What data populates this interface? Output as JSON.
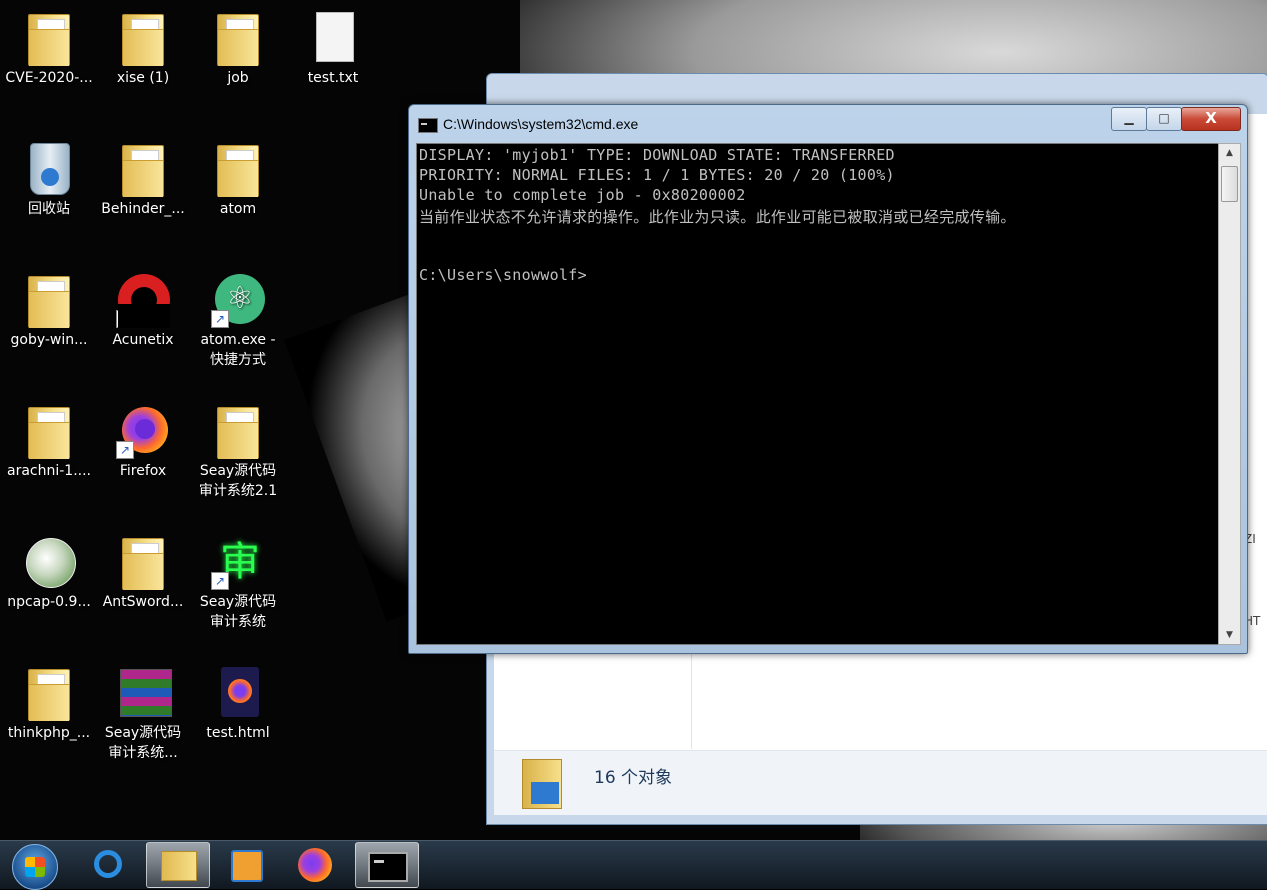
{
  "desktop": {
    "icons": [
      {
        "label": "CVE-2020-...",
        "icon": "folder-icon"
      },
      {
        "label": "xise (1)",
        "icon": "folder-icon"
      },
      {
        "label": "job",
        "icon": "folder-icon"
      },
      {
        "label": "test.txt",
        "icon": "text-file-icon"
      },
      {
        "label": "回收站",
        "icon": "recycle-bin-icon"
      },
      {
        "label": "Behinder_...",
        "icon": "folder-icon"
      },
      {
        "label": "atom",
        "icon": "folder-icon"
      },
      {
        "label": "goby-win...",
        "icon": "folder-icon"
      },
      {
        "label": "Acunetix",
        "icon": "acunetix-icon"
      },
      {
        "label": "atom.exe - 快捷方式",
        "icon": "atom-icon"
      },
      {
        "label": "arachni-1....",
        "icon": "folder-icon"
      },
      {
        "label": "Firefox",
        "icon": "firefox-icon"
      },
      {
        "label": "Seay源代码审计系统2.1",
        "icon": "folder-icon"
      },
      {
        "label": "npcap-0.9...",
        "icon": "npcap-icon"
      },
      {
        "label": "AntSword...",
        "icon": "folder-icon"
      },
      {
        "label": "Seay源代码审计系统",
        "icon": "seay-icon"
      },
      {
        "label": "thinkphp_...",
        "icon": "folder-icon"
      },
      {
        "label": "Seay源代码审计系统...",
        "icon": "winrar-icon"
      },
      {
        "label": "test.html",
        "icon": "html-file-icon"
      }
    ]
  },
  "explorer": {
    "status_count": "16 个对象",
    "peek_texts": [
      "ZI",
      "HT"
    ]
  },
  "cmd": {
    "title": "C:\\Windows\\system32\\cmd.exe",
    "controls": {
      "minimize": "▁",
      "maximize": "□",
      "close": "X"
    },
    "lines": [
      "DISPLAY: 'myjob1' TYPE: DOWNLOAD STATE: TRANSFERRED",
      "PRIORITY: NORMAL FILES: 1 / 1 BYTES: 20 / 20 (100%)",
      "Unable to complete job - 0x80200002",
      "当前作业状态不允许请求的操作。此作业为只读。此作业可能已被取消或已经完成传输。",
      "",
      "",
      "C:\\Users\\snowwolf>"
    ],
    "scroll_up": "▲",
    "scroll_down": "▼"
  },
  "taskbar": {
    "items": [
      {
        "name": "internet-explorer",
        "active": false
      },
      {
        "name": "windows-explorer",
        "active": true
      },
      {
        "name": "media-player",
        "active": false
      },
      {
        "name": "firefox",
        "active": false
      },
      {
        "name": "cmd",
        "active": true
      }
    ]
  }
}
